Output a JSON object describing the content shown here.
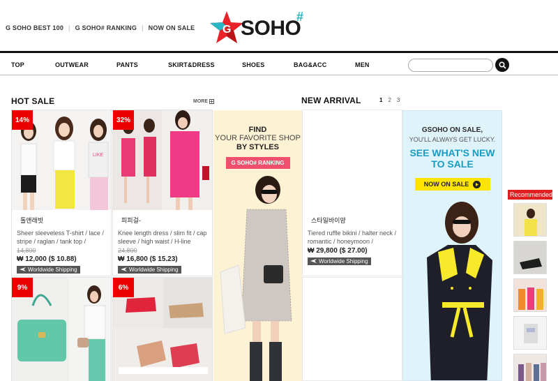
{
  "top_links": [
    "G SOHO BEST 100",
    "G SOHO# RANKING",
    "NOW ON SALE"
  ],
  "logo": {
    "letter": "G",
    "text": "SOHO",
    "hash": "#"
  },
  "nav": {
    "items": [
      "TOP",
      "OUTWEAR",
      "PANTS",
      "SKIRT&DRESS",
      "SHOES",
      "BAG&ACC",
      "MEN"
    ],
    "search_placeholder": ""
  },
  "hot_sale": {
    "title": "HOT SALE",
    "more": "MORE"
  },
  "new_arrival": {
    "title": "NEW ARRIVAL",
    "pages": [
      "1",
      "2",
      "3"
    ]
  },
  "products": [
    {
      "badge": "14%",
      "shop": "톨앤래빗",
      "desc": "Sheer sleeveless T-shirt / lace / stripe / raglan / tank top /",
      "old_price": "14,800",
      "price": "₩ 12,000 ($ 10.88)",
      "shipping": "Worldwide Shipping"
    },
    {
      "badge": "32%",
      "shop": "피피걸-",
      "desc": "Knee length dress / slim fit / cap sleeve / high waist / H-line",
      "old_price": "24,800",
      "price": "₩ 16,800 ($ 15.23)",
      "shipping": "Worldwide Shipping"
    },
    {
      "badge": "",
      "shop": "스타일바이얌",
      "desc": "Tiered ruffle bikini / halter neck / romantic / honeymoon /",
      "old_price": "",
      "price": "₩ 29,800 ($ 27.00)",
      "shipping": "Worldwide Shipping"
    },
    {
      "badge": "9%"
    },
    {
      "badge": "6%"
    }
  ],
  "banner_find": {
    "line1": "FIND",
    "line2": "YOUR FAVORITE SHOP",
    "line3": "BY STYLES",
    "button": "G SOHO# RANKING"
  },
  "banner_sale": {
    "line1": "GSOHO ON SALE,",
    "line2": "YOU'LL ALWAYS GET LUCKY.",
    "line3a": "SEE WHAT'S NEW",
    "line3b": "TO SALE",
    "button": "NOW ON SALE"
  },
  "recommended": {
    "title": "Recommended"
  },
  "colors": {
    "badge": "#ee0000",
    "accent_blue": "#1a9bc2",
    "pink_button": "#f0506e",
    "yellow_button": "#ffe400"
  }
}
